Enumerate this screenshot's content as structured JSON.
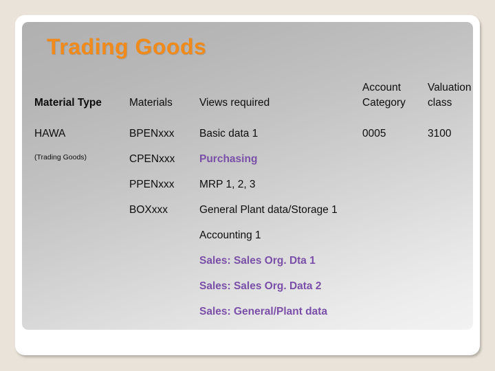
{
  "slide": {
    "title": "Trading Goods",
    "title_color": "#f08a1b",
    "accent_color": "#7a4fa8",
    "background_color": "#e9e3d9"
  },
  "table": {
    "headers": {
      "material_type": "Material Type",
      "materials": "Materials",
      "views_required": "Views required",
      "account_category_line1": "Account",
      "account_category_line2": "Category",
      "valuation_class_line1": "Valuation",
      "valuation_class_line2": "class"
    },
    "material_type": {
      "code": "HAWA",
      "description": "(Trading Goods)"
    },
    "rows": [
      {
        "material": "BPENxxx",
        "view": "Basic data 1",
        "account_category": "0005",
        "valuation_class": "3100",
        "highlight": false
      },
      {
        "material": "CPENxxx",
        "view": "Purchasing",
        "account_category": "",
        "valuation_class": "",
        "highlight": true
      },
      {
        "material": "PPENxxx",
        "view": "MRP 1, 2, 3",
        "account_category": "",
        "valuation_class": "",
        "highlight": false
      },
      {
        "material": "BOXxxx",
        "view": "General Plant data/Storage 1",
        "account_category": "",
        "valuation_class": "",
        "highlight": false
      },
      {
        "material": "",
        "view": "Accounting 1",
        "account_category": "",
        "valuation_class": "",
        "highlight": false
      },
      {
        "material": "",
        "view": "Sales: Sales Org. Dta 1",
        "account_category": "",
        "valuation_class": "",
        "highlight": true
      },
      {
        "material": "",
        "view": "Sales: Sales Org. Data 2",
        "account_category": "",
        "valuation_class": "",
        "highlight": true
      },
      {
        "material": "",
        "view": "Sales: General/Plant data",
        "account_category": "",
        "valuation_class": "",
        "highlight": true
      }
    ]
  }
}
